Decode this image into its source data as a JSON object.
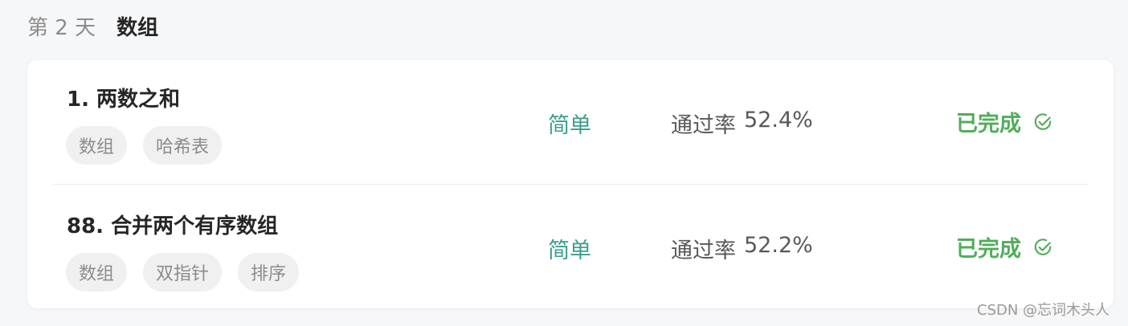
{
  "day": {
    "label": "第 2 天",
    "topic": "数组"
  },
  "problems": [
    {
      "title": "1. 两数之和",
      "tags": [
        "数组",
        "哈希表"
      ],
      "difficulty": "简单",
      "pass_rate_label": "通过率",
      "pass_rate_value": "52.4%",
      "status": "已完成",
      "status_icon": "check-circle-icon"
    },
    {
      "title": "88. 合并两个有序数组",
      "tags": [
        "数组",
        "双指针",
        "排序"
      ],
      "difficulty": "简单",
      "pass_rate_label": "通过率",
      "pass_rate_value": "52.2%",
      "status": "已完成",
      "status_icon": "check-circle-icon"
    }
  ],
  "watermark": "CSDN @忘词木头人",
  "colors": {
    "difficulty_easy": "#3a9e8f",
    "status_done": "#52ad5b",
    "tag_bg": "#f0f0f0",
    "page_bg": "#f6f7f9"
  }
}
